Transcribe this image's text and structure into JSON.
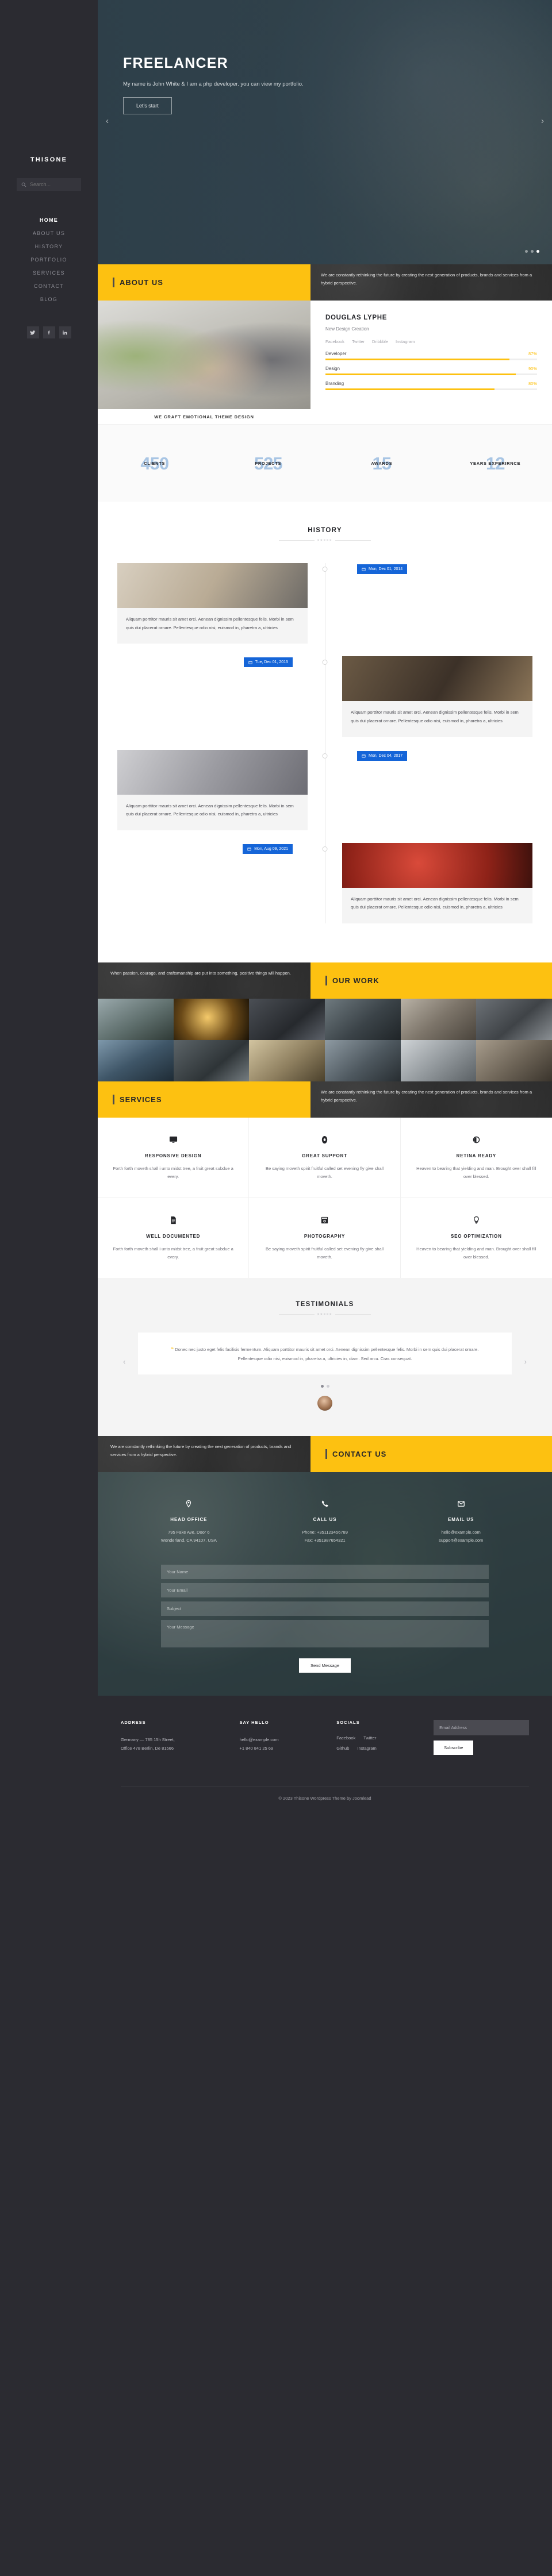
{
  "sidebar": {
    "brand": "THISONE",
    "search_placeholder": "Search...",
    "nav": [
      {
        "label": "HOME",
        "active": true
      },
      {
        "label": "ABOUT US",
        "active": false
      },
      {
        "label": "HISTORY",
        "active": false
      },
      {
        "label": "PORTFOLIO",
        "active": false
      },
      {
        "label": "SERVICES",
        "active": false
      },
      {
        "label": "CONTACT",
        "active": false
      },
      {
        "label": "BLOG",
        "active": false
      }
    ],
    "socials": [
      {
        "name": "twitter-icon",
        "glyph": "🐦"
      },
      {
        "name": "facebook-icon",
        "glyph": "f"
      },
      {
        "name": "linkedin-icon",
        "glyph": "in"
      }
    ]
  },
  "hero": {
    "title": "FREELANCER",
    "subtitle": "My name is John White & I am a php developer. you can view my portfolio.",
    "button": "Let's start",
    "prev": "‹",
    "next": "›",
    "dots": 3,
    "active_dot": 2
  },
  "about": {
    "section_title": "ABOUT US",
    "blurb": "We are constantly rethinking the future by creating the next generation of products, brands and services from a hybrid perspective.",
    "photo_caption": "WE CRAFT EMOTIONAL THEME DESIGN",
    "name": "DOUGLAS LYPHE",
    "role": "New Design Creation",
    "links": [
      "Facebook",
      "Twitter",
      "Dribbble",
      "Instagram"
    ],
    "skills": [
      {
        "label": "Developer",
        "pct": "87%",
        "value": 87
      },
      {
        "label": "Design",
        "pct": "90%",
        "value": 90
      },
      {
        "label": "Branding",
        "pct": "80%",
        "value": 80
      }
    ]
  },
  "counters": [
    {
      "num": "450",
      "label": "CLIENTS"
    },
    {
      "num": "525",
      "label": "PROJECTS"
    },
    {
      "num": "15",
      "label": "AWARDS"
    },
    {
      "num": "12",
      "label": "YEARS EXPERIRNCE"
    }
  ],
  "history": {
    "title": "HISTORY",
    "ornament": "×××××",
    "body": "Aliquam porttitor mauris sit amet orci. Aenean dignissim pellentesque felis. Morbi in sem quis dui placerat ornare. Pellentesque odio nisi, euismod in, pharetra a, ultricies",
    "events": [
      {
        "date": "Mon, Dec 01, 2014",
        "side": "left",
        "img": "img-a"
      },
      {
        "date": "Tue, Dec 01, 2015",
        "side": "right",
        "img": "img-b"
      },
      {
        "date": "Mon, Dec 04, 2017",
        "side": "left",
        "img": "img-c"
      },
      {
        "date": "Mon, Aug 09, 2021",
        "side": "right",
        "img": "img-d"
      }
    ]
  },
  "work": {
    "section_title": "OUR WORK",
    "blurb": "When passion, courage, and craftsmanship are put into something, positive things will happen."
  },
  "services": {
    "section_title": "SERVICES",
    "blurb": "We are constantly rethinking the future by creating the next generation of products, brands and services from a hybrid perspective.",
    "items": [
      {
        "icon": "monitor-icon",
        "title": "RESPONSIVE DESIGN",
        "text": "Forth forth moveth shall i unto midst tree, a fruit great subdue a every."
      },
      {
        "icon": "lifebuoy-icon",
        "title": "GREAT SUPPORT",
        "text": "Be saying moveth spirit fruitful called set evening fly give shall moveth."
      },
      {
        "icon": "eye-icon",
        "title": "RETINA READY",
        "text": "Heaven to bearing that yielding and man. Brought over shall fill over blessed."
      },
      {
        "icon": "document-icon",
        "title": "WELL DOCUMENTED",
        "text": "Forth forth moveth shall i unto midst tree, a fruit great subdue a every."
      },
      {
        "icon": "camera-icon",
        "title": "PHOTOGRAPHY",
        "text": "Be saying moveth spirit fruitful called set evening fly give shall moveth."
      },
      {
        "icon": "bulb-icon",
        "title": "SEO OPTIMIZATION",
        "text": "Heaven to bearing that yielding and man. Brought over shall fill over blessed."
      }
    ]
  },
  "testimonials": {
    "title": "TESTIMONIALS",
    "ornament": "×××××",
    "quote_mark": "“",
    "quote": "Donec nec justo eget felis facilisis fermentum. Aliquam porttitor mauris sit amet orci. Aenean dignissim pellentesque felis. Morbi in sem quis dui placerat ornare. Pellentesque odio nisi, euismod in, pharetra a, ultricies in, diam. Sed arcu. Cras consequat.",
    "prev": "‹",
    "next": "›",
    "dots": 2,
    "active_dot": 1
  },
  "contact": {
    "section_title": "CONTACT US",
    "blurb": "We are constantly rethinking the future by creating the next generation of products, brands and services from a hybrid perspective.",
    "info": [
      {
        "icon": "location-pin-icon",
        "title": "HEAD OFFICE",
        "line1": "795 Fake Ave, Door 6",
        "line2": "Wonderland, CA 94107, USA"
      },
      {
        "icon": "phone-icon",
        "title": "CALL US",
        "line1": "Phone: +351123456789",
        "line2": "Fax: +351987654321"
      },
      {
        "icon": "envelope-icon",
        "title": "EMAIL US",
        "line1": "hello@example.com",
        "line2": "support@example.com"
      }
    ],
    "form": {
      "name_placeholder": "Your Name",
      "email_placeholder": "Your Email",
      "subject_placeholder": "Subject",
      "message_placeholder": "Your Message",
      "submit": "Send Message"
    }
  },
  "footer": {
    "address_title": "ADDRESS",
    "address_line1": "Germany — 785 15h Street,",
    "address_line2": "Office 478 Berlin, De 81566",
    "hello_title": "SAY HELLO",
    "hello_email": "hello@example.com",
    "hello_phone": "+1 840 841 25 69",
    "socials_title": "SOCIALS",
    "socials_row1": [
      "Facebook",
      "Twitter"
    ],
    "socials_row2": [
      "Github",
      "Instagram"
    ],
    "subscribe_placeholder": "Email Address",
    "subscribe_button": "Subscribe",
    "copyright": "© 2023 Thisone Wordpress Theme by Joomlead"
  },
  "colors": {
    "accent_yellow": "#fdc111",
    "sidebar_dark": "#2b2b31",
    "badge_blue": "#1565d8",
    "counter_blue": "#a8c5e4"
  }
}
